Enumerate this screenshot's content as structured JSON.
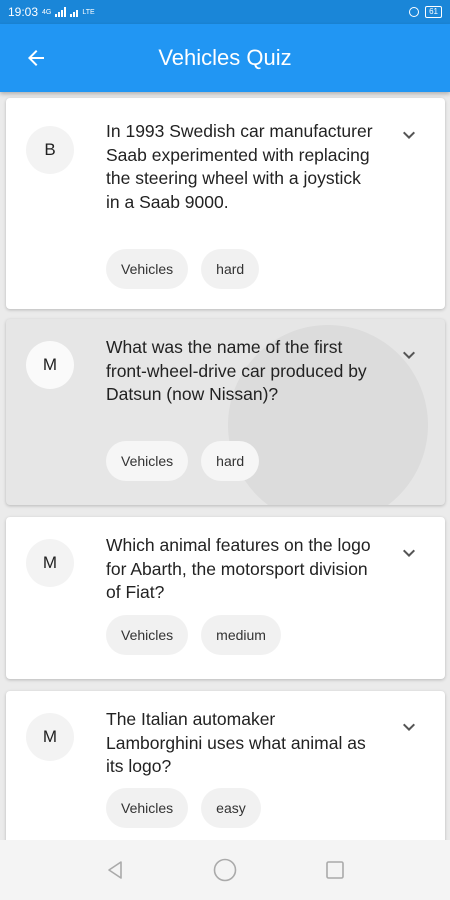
{
  "status_bar": {
    "time": "19:03",
    "network": "4G",
    "lte": "LTE",
    "battery": "61"
  },
  "app_bar": {
    "title": "Vehicles Quiz",
    "back_icon": "arrow-back-icon"
  },
  "questions": [
    {
      "avatar": "B",
      "text": "In 1993 Swedish car manufacturer Saab experimented with replacing the steering wheel with a joystick in a Saab 9000.",
      "category": "Vehicles",
      "difficulty": "hard"
    },
    {
      "avatar": "M",
      "text": "What was the name of the first front-wheel-drive car produced by Datsun (now Nissan)?",
      "category": "Vehicles",
      "difficulty": "hard"
    },
    {
      "avatar": "M",
      "text": "Which animal features on the logo for Abarth, the motorsport division of Fiat?",
      "category": "Vehicles",
      "difficulty": "medium"
    },
    {
      "avatar": "M",
      "text": "The Italian automaker Lamborghini uses what animal as its logo?",
      "category": "Vehicles",
      "difficulty": "easy"
    }
  ],
  "nav_bar": {
    "icons": [
      "back-triangle-icon",
      "home-circle-icon",
      "recents-square-icon"
    ]
  }
}
